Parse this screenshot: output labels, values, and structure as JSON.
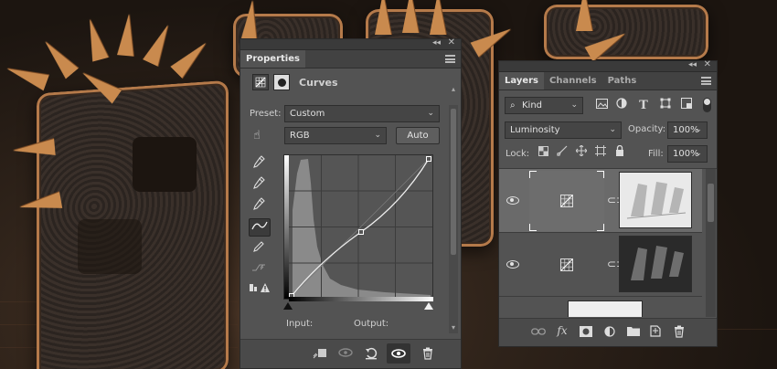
{
  "properties": {
    "title": "Properties",
    "adjustment_name": "Curves",
    "preset_label": "Preset:",
    "preset_value": "Custom",
    "channel_value": "RGB",
    "auto_label": "Auto",
    "input_label": "Input:",
    "output_label": "Output:"
  },
  "layers": {
    "tabs": [
      "Layers",
      "Channels",
      "Paths"
    ],
    "filter_kind": "Kind",
    "blend_mode": "Luminosity",
    "opacity_label": "Opacity:",
    "opacity_value": "100%",
    "lock_label": "Lock:",
    "fill_label": "Fill:",
    "fill_value": "100%"
  },
  "colors": {
    "panel": "#535353",
    "panel_dark": "#424242",
    "accent_copper": "#c98a4e"
  },
  "icons": {
    "collapse": "collapse-icon",
    "close": "close-icon",
    "menu": "panel-menu-icon"
  }
}
